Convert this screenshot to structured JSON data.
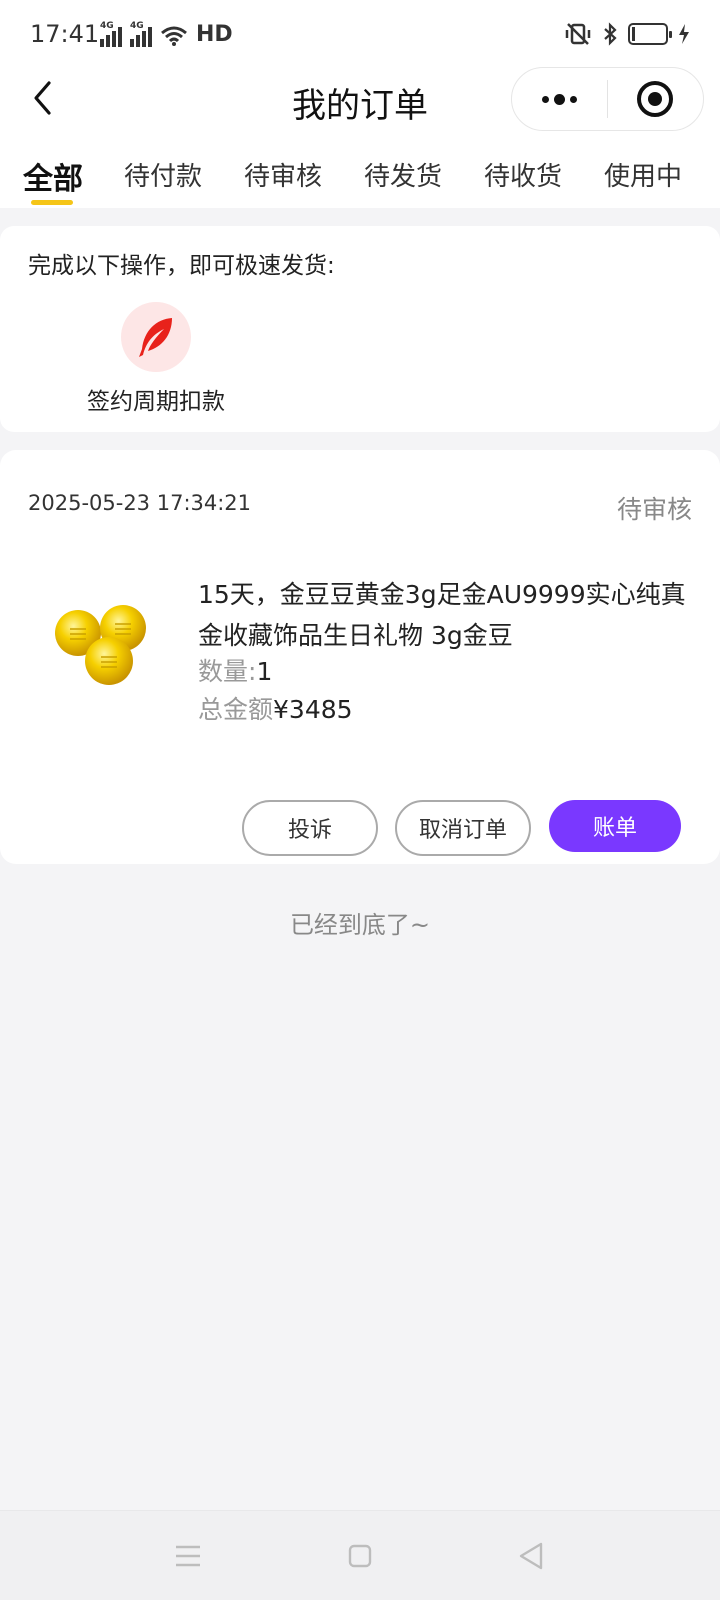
{
  "status_bar": {
    "time": "17:41",
    "network_1": "4G",
    "network_2": "4G",
    "wifi_label": "HD",
    "icons": [
      "signal-icon",
      "signal-icon",
      "wifi-icon",
      "vibrate-mute-icon",
      "bluetooth-icon",
      "battery-icon",
      "charging-icon"
    ]
  },
  "nav": {
    "title": "我的订单",
    "back_icon": "chevron-left-icon",
    "more_icon": "more-dots-icon",
    "close_icon": "target-circle-icon"
  },
  "tabs": [
    {
      "label": "全部",
      "active": true
    },
    {
      "label": "待付款",
      "active": false
    },
    {
      "label": "待审核",
      "active": false
    },
    {
      "label": "待发货",
      "active": false
    },
    {
      "label": "待收货",
      "active": false
    },
    {
      "label": "使用中",
      "active": false
    }
  ],
  "colors": {
    "tab_indicator": "#f5c518",
    "primary_button": "#7a38ff",
    "sign_icon_bg": "#fde6e6",
    "sign_icon": "#e8221b",
    "gold": "#f2c200"
  },
  "sign_section": {
    "hint": "完成以下操作，即可极速发货:",
    "action_label": "签约周期扣款",
    "action_icon": "feather-icon"
  },
  "order": {
    "time": "2025-05-23 17:34:21",
    "status": "待审核",
    "product_title": "15天，金豆豆黄金3g足金AU9999实心纯真金收藏饰品生日礼物 3g金豆",
    "qty_label": "数量:",
    "qty_value": "1",
    "total_label": "总金额",
    "total_value": "¥3485",
    "buttons": {
      "complain": "投诉",
      "cancel": "取消订单",
      "bill": "账单"
    }
  },
  "end_tip": "已经到底了~",
  "system_nav": {
    "icons": [
      "menu-icon",
      "home-square-icon",
      "back-triangle-icon"
    ]
  }
}
